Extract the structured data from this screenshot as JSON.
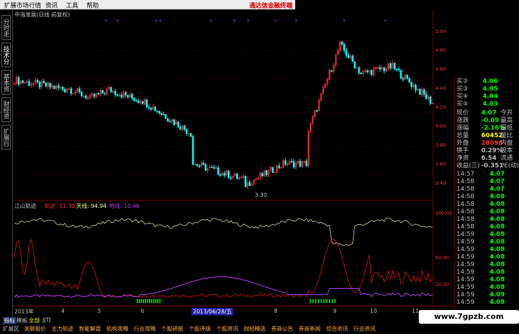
{
  "menu": [
    "扩展市场行情",
    "资讯",
    "工具",
    "帮助"
  ],
  "brand": "通达信金融终端",
  "left_tabs": [
    "分时走势",
    "技术分析",
    "基本资料",
    "财经资讯",
    "扩展行情"
  ],
  "main_chart": {
    "title": "中海发展(日线 前复权)",
    "low_label": "3.30",
    "y_ticks": [
      "5.00",
      "4.80",
      "4.60",
      "4.40",
      "4.20",
      "4.00",
      "3.80",
      "3.60",
      "3.40"
    ]
  },
  "indicator": {
    "name": "江山轨迹",
    "line1_label": "轨迹: 11.30",
    "line2_label": "天线: 94.94",
    "line3_label": "地线: 10.46",
    "y_ticks": [
      "100.00",
      "50.00",
      "20.00"
    ]
  },
  "x_axis": {
    "year": "2013年",
    "months": [
      "4",
      "5",
      "6",
      "7",
      "8",
      "9",
      "10",
      "11"
    ],
    "cursor_date": "2013/06/28/五"
  },
  "indicator_tabs": [
    "指标",
    "模板",
    "全部",
    "JJTJ"
  ],
  "quote": {
    "top": [
      {
        "label": "买②",
        "value": "4.06"
      },
      {
        "label": "买③",
        "value": "4.05"
      },
      {
        "label": "买④",
        "value": "4.04"
      },
      {
        "label": "买⑤",
        "value": "4.03"
      }
    ],
    "stats": [
      {
        "l1": "现价",
        "v1": "4.07",
        "l2": "今开",
        "c1": "#00ff00"
      },
      {
        "l1": "涨跌",
        "v1": "-0.09",
        "l2": "最高",
        "c1": "#00ff00"
      },
      {
        "l1": "涨幅",
        "v1": "-2.16%",
        "l2": "最低",
        "c1": "#00ff00"
      },
      {
        "l1": "总量",
        "v1": "60452",
        "l2": "量比",
        "c1": "#ffff00"
      },
      {
        "l1": "外盘",
        "v1": "28098",
        "l2": "内盘",
        "c1": "#ff3030"
      },
      {
        "l1": "换手",
        "v1": "0.29%",
        "l2": "股本",
        "c1": "#c0c0c0"
      },
      {
        "l1": "净资",
        "v1": "6.54",
        "l2": "流通",
        "c1": "#c0c0c0"
      },
      {
        "l1": "收益(三)",
        "v1": "-0.351",
        "l2": "PE(动)",
        "c1": "#c0c0c0"
      }
    ],
    "ticks": [
      {
        "t": "14:57",
        "p": "4.07"
      },
      {
        "t": "14:58",
        "p": "4.07"
      },
      {
        "t": "14:58",
        "p": "4.07"
      },
      {
        "t": "14:58",
        "p": "4.08"
      },
      {
        "t": "14:58",
        "p": "4.08"
      },
      {
        "t": "14:58",
        "p": "4.08"
      },
      {
        "t": "14:58",
        "p": "4.08"
      },
      {
        "t": "14:58",
        "p": "4.08"
      },
      {
        "t": "14:59",
        "p": "4.08"
      },
      {
        "t": "14:59",
        "p": "4.08"
      },
      {
        "t": "14:59",
        "p": "4.08"
      },
      {
        "t": "14:59",
        "p": "4.08"
      },
      {
        "t": "14:59",
        "p": "4.08"
      },
      {
        "t": "14:59",
        "p": "4.08"
      },
      {
        "t": "14:59",
        "p": "4.08"
      },
      {
        "t": "14:59",
        "p": "4.08"
      },
      {
        "t": "14:59",
        "p": "4.09"
      },
      {
        "t": "14:59",
        "p": "4.08"
      }
    ]
  },
  "bottom_tabs": [
    "扩展区",
    "关联报价",
    "主力轨迹",
    "智能解盘",
    "机构攻略",
    "行业攻略",
    "个股研报",
    "个股评级",
    "个股资讯",
    "财经精选",
    "券商公告",
    "券商新闻",
    "综合资讯",
    "行业资讯"
  ],
  "watermark": "www.7gpzb.com",
  "colors": {
    "up": "#ff3030",
    "down": "#00ffff",
    "guiji": "#c0c0c0",
    "tianxian": "#ffff80",
    "dixian": "#c040ff",
    "red_line": "#c01010"
  }
}
